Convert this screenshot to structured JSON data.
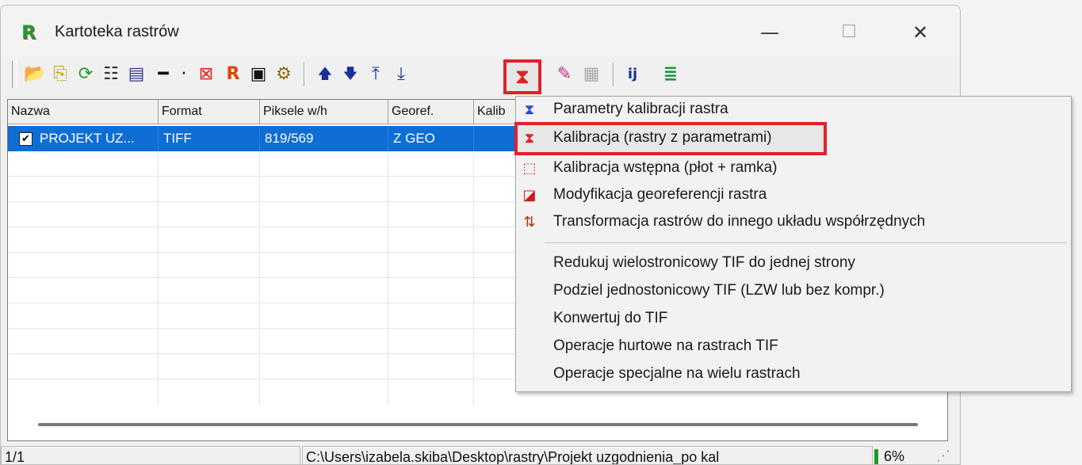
{
  "window": {
    "title": "Kartoteka rastrów",
    "controls": {
      "minimize": "—",
      "maximize": "☐",
      "close": "✕"
    }
  },
  "toolbar": {
    "buttons": [
      {
        "icon": "add-raster-icon",
        "glyph": "📂"
      },
      {
        "icon": "add-multiple-icon",
        "glyph": "⎘"
      },
      {
        "icon": "refresh-raster-icon",
        "glyph": "⟳"
      },
      {
        "icon": "tree-icon",
        "glyph": "☷"
      },
      {
        "icon": "raster-props-icon",
        "glyph": "▤"
      },
      {
        "icon": "remove-icon",
        "glyph": "━"
      },
      {
        "icon": "dropdown-small-icon",
        "glyph": "·"
      },
      {
        "icon": "delete-raster-icon",
        "glyph": "⊠"
      },
      {
        "icon": "rap-icon",
        "glyph": "R"
      },
      {
        "icon": "save-icon",
        "glyph": "▣"
      },
      {
        "icon": "settings-icon",
        "glyph": "⚙"
      },
      {
        "icon": "move-up-icon",
        "glyph": "🡅"
      },
      {
        "icon": "move-down-icon",
        "glyph": "🡇"
      },
      {
        "icon": "move-top-icon",
        "glyph": "⤒"
      },
      {
        "icon": "move-bottom-icon",
        "glyph": "⤓"
      },
      {
        "icon": "calibration-icon",
        "glyph": "⧗"
      },
      {
        "icon": "brush-icon",
        "glyph": "✎"
      },
      {
        "icon": "layers-icon",
        "glyph": "▦"
      },
      {
        "icon": "index-icon",
        "glyph": "ij"
      },
      {
        "icon": "stack-r-icon",
        "glyph": "≣"
      }
    ]
  },
  "table": {
    "columns": [
      "Nazwa",
      "Format",
      "Piksele w/h",
      "Georef.",
      "Kalib"
    ],
    "rows": [
      {
        "name": "PROJEKT UZ...",
        "format": "TIFF",
        "pixels": "819/569",
        "georef": "Z GEO",
        "kalib": "",
        "checked": "✔"
      }
    ]
  },
  "statusbar": {
    "count": "1/1",
    "path": "C:\\Users\\izabela.skiba\\Desktop\\rastry\\Projekt uzgodnienia_po kal",
    "percent": "6%",
    "progress": 0.06
  },
  "menu": {
    "group1": [
      {
        "label": "Parametry kalibracji rastra",
        "icon": "calibration-params-icon",
        "glyph": "⧗",
        "color": "#2a4ec9"
      },
      {
        "label": "Kalibracja (rastry z parametrami)",
        "icon": "calibration-icon",
        "glyph": "⧗",
        "color": "#e3202a"
      },
      {
        "label": "Kalibracja wstępna (płot + ramka)",
        "icon": "pre-calibration-icon",
        "glyph": "⬚",
        "color": "#d12c2c"
      },
      {
        "label": "Modyfikacja georeferencji rastra",
        "icon": "georef-modify-icon",
        "glyph": "◪",
        "color": "#c81e1e"
      },
      {
        "label": "Transformacja rastrów do innego układu współrzędnych",
        "icon": "transform-icon",
        "glyph": "⇅",
        "color": "#b0320e"
      }
    ],
    "group2": [
      {
        "label": "Redukuj wielostronicowy TIF do jednej strony"
      },
      {
        "label": "Podziel jednostonicowy TIF (LZW lub bez kompr.)"
      },
      {
        "label": "Konwertuj do TIF"
      },
      {
        "label": "Operacje hurtowe na rastrach TIF"
      },
      {
        "label": "Operacje specjalne na wielu rastrach"
      }
    ]
  },
  "accent": {
    "highlight": "#e3202a",
    "selection": "#0f6dd6"
  }
}
